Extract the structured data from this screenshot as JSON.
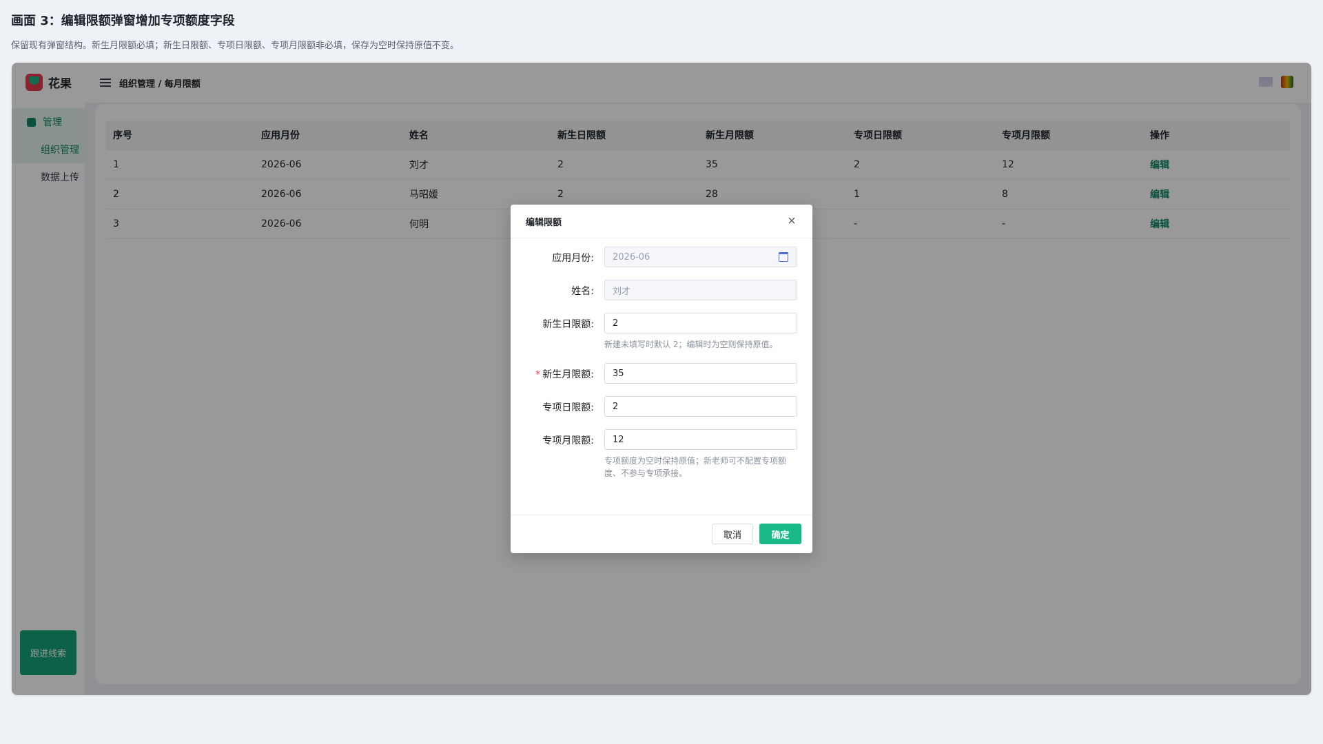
{
  "page": {
    "heading": "画面 3：编辑限额弹窗增加专项额度字段",
    "description": "保留现有弹窗结构。新生月限额必填；新生日限额、专项日限额、专项月限额非必填，保存为空时保持原值不变。"
  },
  "app": {
    "logo_text": "花果",
    "breadcrumb": "组织管理 / 每月限额",
    "sidebar": {
      "group": "管理",
      "items": [
        {
          "label": "组织管理",
          "active": true
        },
        {
          "label": "数据上传",
          "active": false
        }
      ],
      "follow_button": "跟进线索"
    }
  },
  "table": {
    "headers": [
      "序号",
      "应用月份",
      "姓名",
      "新生日限额",
      "新生月限额",
      "专项日限额",
      "专项月限额",
      "操作"
    ],
    "rows": [
      [
        "1",
        "2026-06",
        "刘才",
        "2",
        "35",
        "2",
        "12",
        "编辑"
      ],
      [
        "2",
        "2026-06",
        "马昭媛",
        "2",
        "28",
        "1",
        "8",
        "编辑"
      ],
      [
        "3",
        "2026-06",
        "何明",
        "",
        "",
        "-",
        "-",
        "编辑"
      ]
    ]
  },
  "dialog": {
    "title": "编辑限额",
    "close_symbol": "×",
    "fields": {
      "month": {
        "label": "应用月份:",
        "value": "2026-06"
      },
      "name": {
        "label": "姓名:",
        "value": "刘才"
      },
      "new_daily": {
        "label": "新生日限额:",
        "value": "2",
        "hint": "新建未填写时默认 2；编辑时为空则保持原值。"
      },
      "new_monthly": {
        "label": "新生月限额:",
        "value": "35",
        "required_mark": "*"
      },
      "special_daily": {
        "label": "专项日限额:",
        "value": "2"
      },
      "special_monthly": {
        "label": "专项月限额:",
        "value": "12",
        "hint": "专项额度为空时保持原值；新老师可不配置专项额度、不参与专项承接。"
      }
    },
    "cancel_label": "取消",
    "ok_label": "确定"
  },
  "colors": {
    "brand": "#19b98a",
    "link": "#12876a",
    "required": "#e8394d"
  }
}
